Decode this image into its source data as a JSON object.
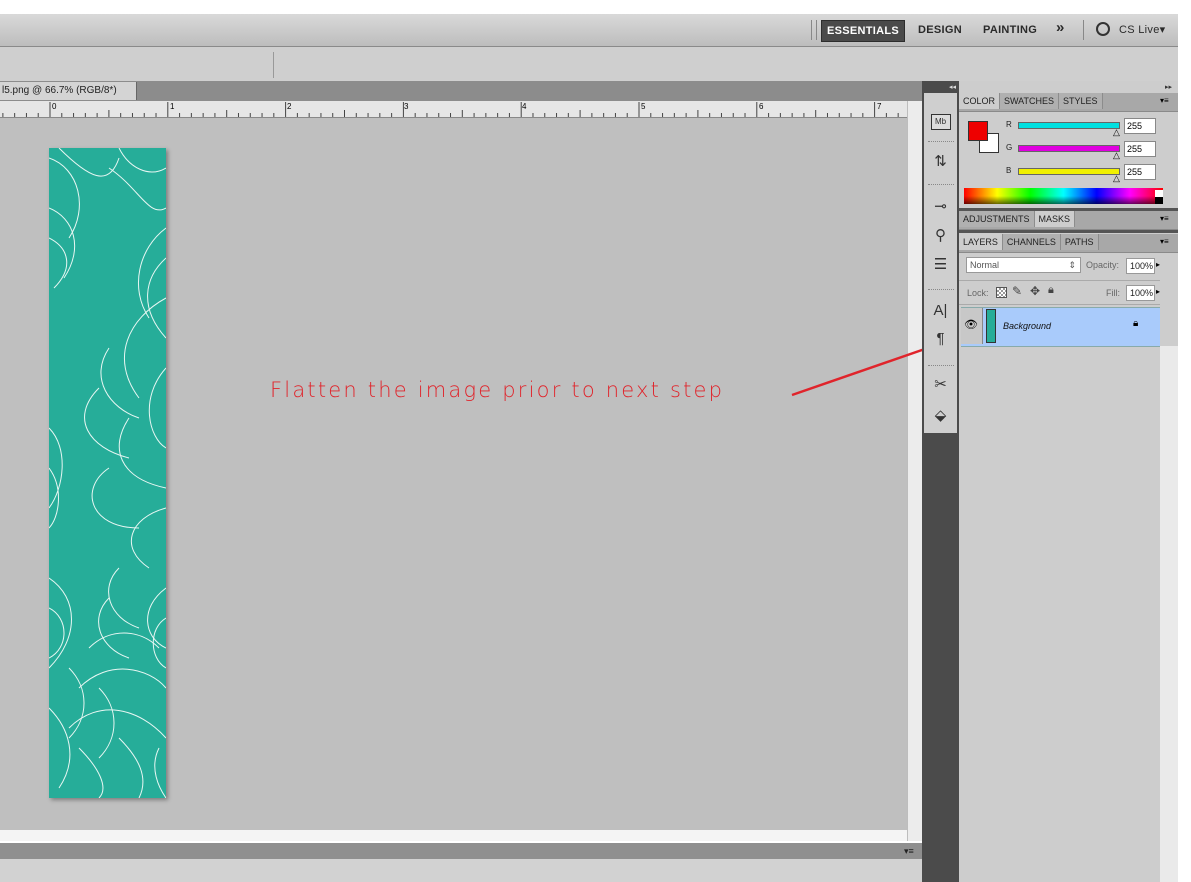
{
  "workspace": {
    "essentials": "ESSENTIALS",
    "design": "DESIGN",
    "painting": "PAINTING",
    "more": "»",
    "cs_live": "CS Live"
  },
  "document": {
    "tab_title": "l5.png @ 66.7% (RGB/8*)",
    "ruler_numbers": [
      "0",
      "1",
      "2",
      "3",
      "4",
      "5",
      "6",
      "7"
    ],
    "fill_color": "#26ad99"
  },
  "annotation": {
    "text": "Flatten the image prior to next step",
    "color": "#e0242b"
  },
  "color_panel": {
    "tabs": [
      "COLOR",
      "SWATCHES",
      "STYLES"
    ],
    "foreground": "#ee0000",
    "background": "#ffffff",
    "channels": [
      {
        "label": "R",
        "value": "255",
        "color": "#00e0e0"
      },
      {
        "label": "G",
        "value": "255",
        "color": "#e000e0"
      },
      {
        "label": "B",
        "value": "255",
        "color": "#f0f000"
      }
    ]
  },
  "adjustments_panel": {
    "tabs": [
      "ADJUSTMENTS",
      "MASKS"
    ]
  },
  "layers_panel": {
    "tabs": [
      "LAYERS",
      "CHANNELS",
      "PATHS"
    ],
    "blend_mode": "Normal",
    "opacity_label": "Opacity:",
    "opacity_value": "100%",
    "lock_label": "Lock:",
    "fill_label": "Fill:",
    "fill_value": "100%",
    "layers": [
      {
        "name": "Background",
        "locked": true,
        "visible": true
      }
    ]
  },
  "icons": [
    "mini-bridge-icon",
    "history-icon",
    "brush-presets-icon",
    "clone-source-icon",
    "tool-presets-icon",
    "character-icon",
    "paragraph-icon",
    "tools-icon",
    "3d-icon"
  ]
}
